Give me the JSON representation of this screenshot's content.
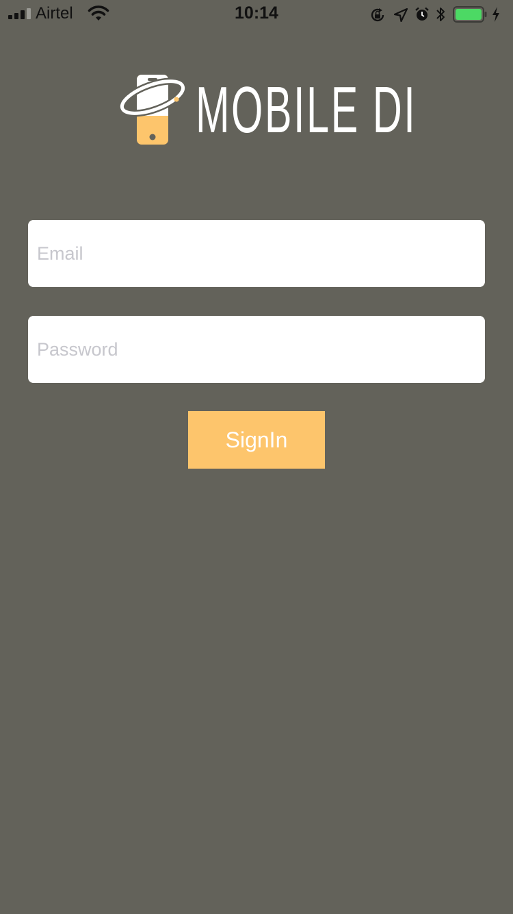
{
  "status_bar": {
    "carrier": "Airtel",
    "time": "10:14",
    "battery_color": "#4cd964"
  },
  "logo": {
    "text": "MOBILE DI",
    "accent_color": "#fdc56c"
  },
  "form": {
    "email_placeholder": "Email",
    "password_placeholder": "Password",
    "signin_label": "SignIn"
  },
  "colors": {
    "background": "#63625a",
    "button": "#fdc56c"
  }
}
